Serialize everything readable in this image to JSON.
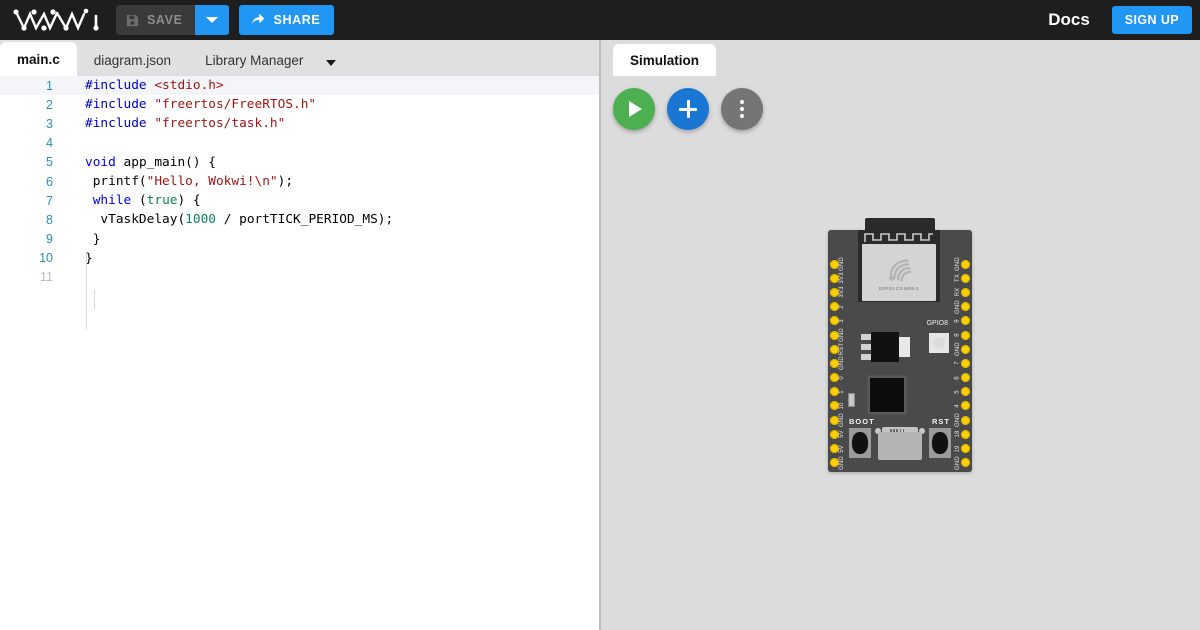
{
  "topbar": {
    "logo_text": "WOKWI",
    "logo_icon": "wokwi-logo",
    "save_label": "SAVE",
    "save_icon": "floppy-disk-icon",
    "save_caret_icon": "chevron-down-icon",
    "share_label": "SHARE",
    "share_icon": "share-arrow-icon",
    "docs_label": "Docs",
    "signup_label": "SIGN UP",
    "background_color": "#1e1e1e",
    "accent_color": "#2196f3"
  },
  "editor": {
    "tabs": [
      {
        "label": "main.c",
        "active": true
      },
      {
        "label": "diagram.json",
        "active": false
      },
      {
        "label": "Library Manager",
        "active": false
      }
    ],
    "tab_overflow_icon": "chevron-down-icon",
    "lines": [
      {
        "no": "1",
        "tokens": [
          {
            "t": "#include ",
            "c": "pre"
          },
          {
            "t": "<stdio.h>",
            "c": "str"
          }
        ]
      },
      {
        "no": "2",
        "tokens": [
          {
            "t": "#include ",
            "c": "pre"
          },
          {
            "t": "\"freertos/FreeRTOS.h\"",
            "c": "str"
          }
        ]
      },
      {
        "no": "3",
        "tokens": [
          {
            "t": "#include ",
            "c": "pre"
          },
          {
            "t": "\"freertos/task.h\"",
            "c": "str"
          }
        ]
      },
      {
        "no": "4",
        "tokens": []
      },
      {
        "no": "5",
        "tokens": [
          {
            "t": "void",
            "c": "kw"
          },
          {
            "t": " app_main() {",
            "c": "plain"
          }
        ]
      },
      {
        "no": "6",
        "tokens": [
          {
            "t": " printf(",
            "c": "plain"
          },
          {
            "t": "\"Hello, Wokwi!\\n\"",
            "c": "str"
          },
          {
            "t": ");",
            "c": "plain"
          }
        ]
      },
      {
        "no": "7",
        "tokens": [
          {
            "t": " ",
            "c": "plain"
          },
          {
            "t": "while",
            "c": "kw"
          },
          {
            "t": " (",
            "c": "plain"
          },
          {
            "t": "true",
            "c": "num"
          },
          {
            "t": ") {",
            "c": "plain"
          }
        ]
      },
      {
        "no": "8",
        "tokens": [
          {
            "t": "  vTaskDelay(",
            "c": "plain"
          },
          {
            "t": "1000",
            "c": "num"
          },
          {
            "t": " / portTICK_PERIOD_MS);",
            "c": "plain"
          }
        ]
      },
      {
        "no": "9",
        "tokens": [
          {
            "t": " }",
            "c": "plain"
          }
        ]
      },
      {
        "no": "10",
        "tokens": [
          {
            "t": "}",
            "c": "plain"
          }
        ]
      },
      {
        "no": "11",
        "tokens": [],
        "dim": true
      }
    ]
  },
  "simulation": {
    "tab_label": "Simulation",
    "controls": [
      {
        "name": "start-simulation-button",
        "icon": "play-icon",
        "color": "#4caf50"
      },
      {
        "name": "add-part-button",
        "icon": "plus-icon",
        "color": "#1976d2"
      },
      {
        "name": "simulation-menu-button",
        "icon": "kebab-menu-icon",
        "color": "#757575"
      }
    ],
    "background_color": "#dcdcdc"
  },
  "board": {
    "name": "ESP32-C3-MINI-1",
    "module_label": "ESP32-C3-MINI-1",
    "module_logo_icon": "espressif-logo",
    "led_label": "GPIO8",
    "boot_label": "BOOT",
    "rst_label": "RST",
    "pcb_color": "#4a4a4a",
    "pin_color": "#ffd000",
    "left_pins": [
      "GND",
      "3V3",
      "3V3",
      "2",
      "3",
      "GND",
      "RST",
      "GND",
      "0",
      "1",
      "10",
      "GND",
      "5V",
      "5V",
      "GND"
    ],
    "right_pins": [
      "GND",
      "TX",
      "RX",
      "GND",
      "9",
      "8",
      "GND",
      "7",
      "6",
      "5",
      "4",
      "GND",
      "18",
      "19",
      "GND"
    ]
  }
}
